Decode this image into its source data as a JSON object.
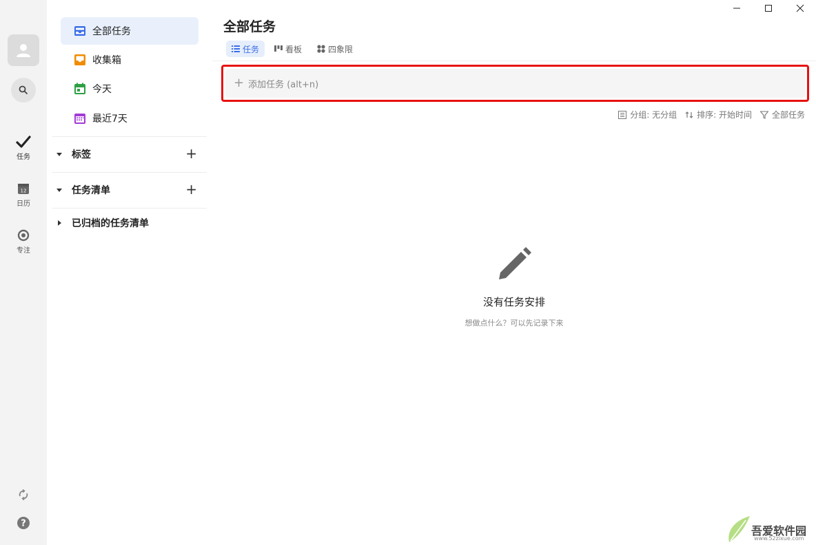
{
  "window": {
    "minimize_label": "minimize",
    "maximize_label": "maximize",
    "close_label": "close"
  },
  "rail": {
    "items": [
      {
        "label": "任务",
        "icon": "check-icon"
      },
      {
        "label": "日历",
        "icon": "calendar-icon",
        "badge": "12"
      },
      {
        "label": "专注",
        "icon": "focus-icon"
      }
    ]
  },
  "sidebar": {
    "items": [
      {
        "label": "全部任务",
        "icon": "inbox-tray-icon",
        "color": "#3a6ee8"
      },
      {
        "label": "收集箱",
        "icon": "inbox-icon",
        "color": "#f08c00"
      },
      {
        "label": "今天",
        "icon": "calendar-today-icon",
        "color": "#2ea043"
      },
      {
        "label": "最近7天",
        "icon": "calendar-week-icon",
        "color": "#a33ad6"
      }
    ],
    "sections": [
      {
        "label": "标签",
        "expanded": true,
        "has_add": true
      },
      {
        "label": "任务清单",
        "expanded": true,
        "has_add": true
      },
      {
        "label": "已归档的任务清单",
        "expanded": false,
        "has_add": false
      }
    ]
  },
  "main": {
    "title": "全部任务",
    "tabs": [
      {
        "label": "任务",
        "icon": "list-icon"
      },
      {
        "label": "看板",
        "icon": "kanban-icon"
      },
      {
        "label": "四象限",
        "icon": "quadrant-icon"
      }
    ],
    "add_task_placeholder": "添加任务 (alt+n)",
    "toolbar": {
      "group_label": "分组: 无分组",
      "sort_label": "排序: 开始时间",
      "filter_label": "全部任务"
    },
    "empty_state": {
      "title": "没有任务安排",
      "subtitle": "想做点什么？可以先记录下来"
    }
  },
  "watermark": {
    "brand": "吾爱软件园",
    "site": "www.52zixue.com"
  },
  "colors": {
    "accent": "#3a6ee8",
    "highlight_border": "#e81010"
  }
}
